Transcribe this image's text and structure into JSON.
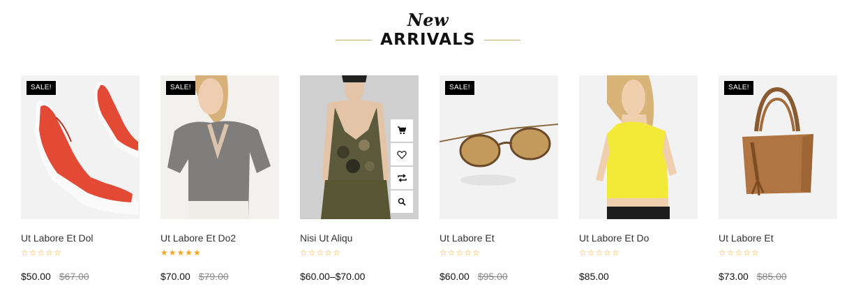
{
  "heading": {
    "script": "New",
    "title": "ARRIVALS"
  },
  "accent_color": "#c9a96e",
  "star_color": "#f5a623",
  "products": [
    {
      "name": "Ut Labore Et Dol",
      "sale_badge": "SALE!",
      "rating": 0,
      "price": "$50.00",
      "old_price": "$67.00",
      "image": "red-sneakers"
    },
    {
      "name": "Ut Labore Et Do2",
      "sale_badge": "SALE!",
      "rating": 5,
      "price": "$70.00",
      "old_price": "$79.00",
      "image": "grey-blouse"
    },
    {
      "name": "Nisi Ut Aliqu",
      "rating": 0,
      "price": "$60.00–$70.00",
      "image": "camo-tank",
      "actions": [
        "cart-icon",
        "heart-icon",
        "compare-icon",
        "search-icon"
      ]
    },
    {
      "name": "Ut Labore Et",
      "sale_badge": "SALE!",
      "rating": 0,
      "price": "$60.00",
      "old_price": "$95.00",
      "image": "sunglasses"
    },
    {
      "name": "Ut Labore Et Do",
      "rating": 0,
      "price": "$85.00",
      "image": "yellow-top"
    },
    {
      "name": "Ut Labore Et",
      "sale_badge": "SALE!",
      "rating": 0,
      "price": "$73.00",
      "old_price": "$85.00",
      "image": "brown-handbag"
    }
  ]
}
